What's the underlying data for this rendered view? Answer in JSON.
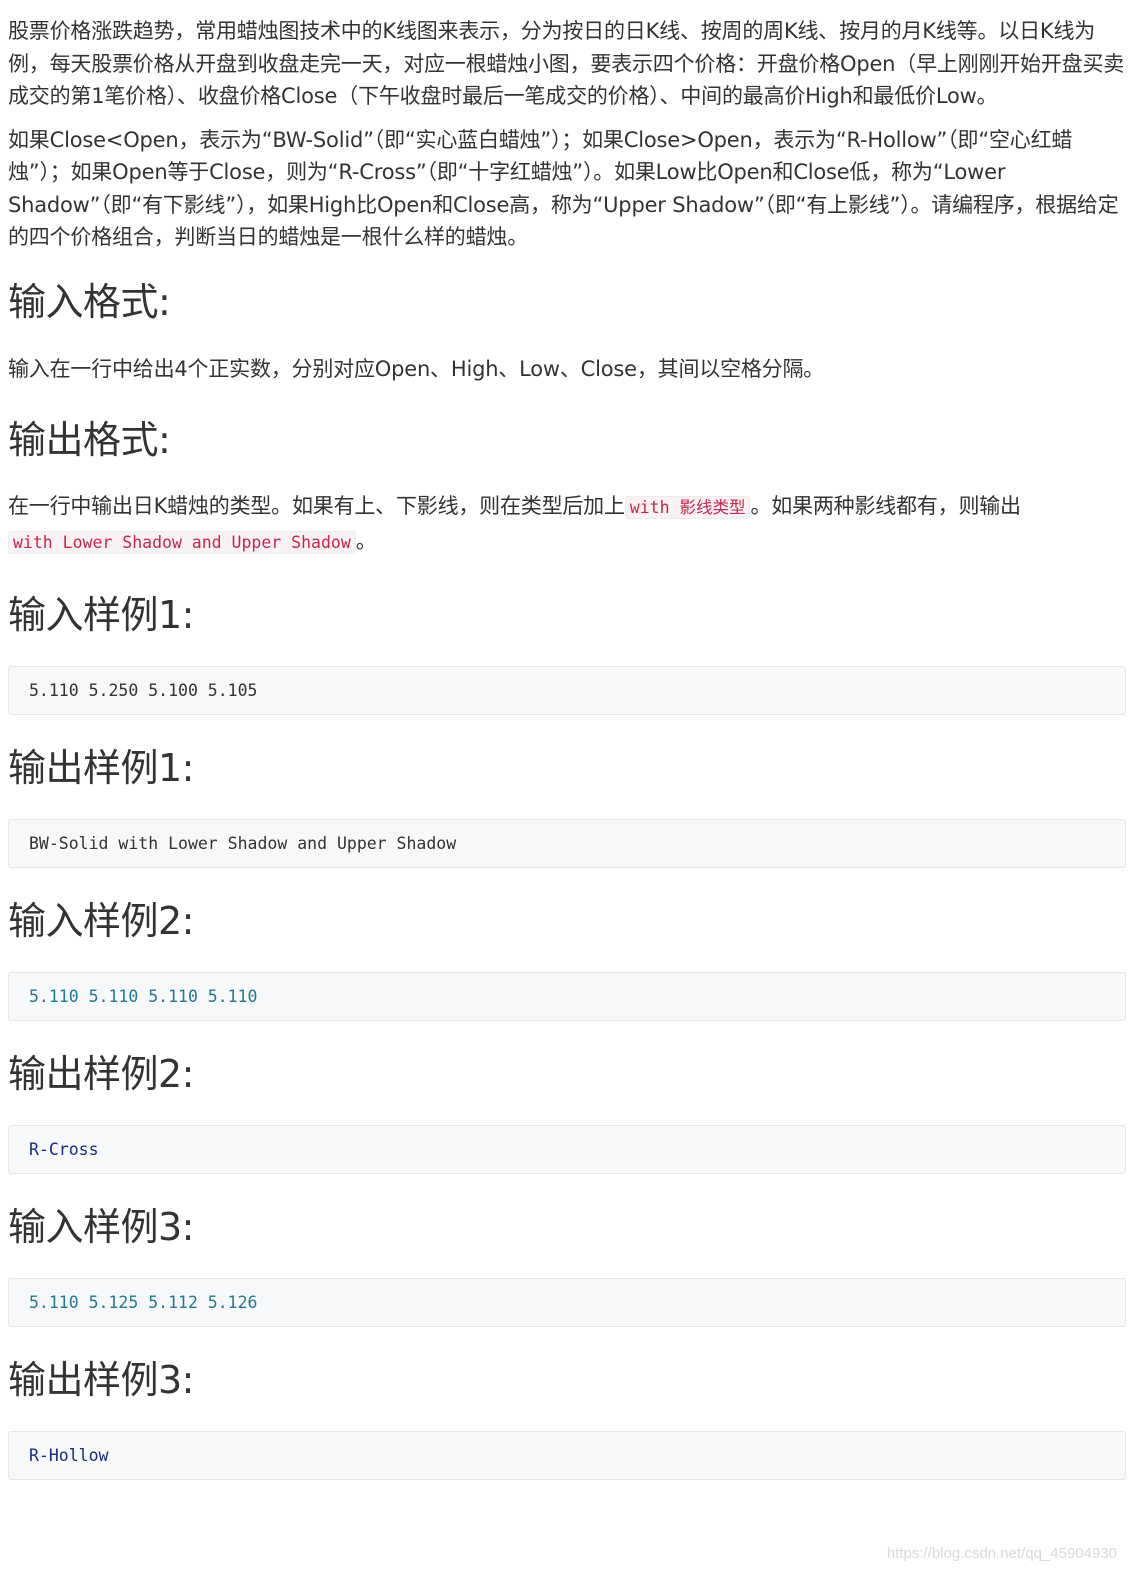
{
  "description": {
    "paragraph1": "股票价格涨跌趋势，常用蜡烛图技术中的K线图来表示，分为按日的日K线、按周的周K线、按月的月K线等。以日K线为例，每天股票价格从开盘到收盘走完一天，对应一根蜡烛小图，要表示四个价格：开盘价格Open（早上刚刚开始开盘买卖成交的第1笔价格）、收盘价格Close（下午收盘时最后一笔成交的价格）、中间的最高价High和最低价Low。",
    "paragraph2": "如果Close<Open，表示为“BW-Solid”（即“实心蓝白蜡烛”）；如果Close>Open，表示为“R-Hollow”（即“空心红蜡烛”）；如果Open等于Close，则为“R-Cross”（即“十字红蜡烛”）。如果Low比Open和Close低，称为“Lower Shadow”（即“有下影线”），如果High比Open和Close高，称为“Upper Shadow”（即“有上影线”）。请编程序，根据给定的四个价格组合，判断当日的蜡烛是一根什么样的蜡烛。"
  },
  "input_format": {
    "heading": "输入格式:",
    "text": "输入在一行中给出4个正实数，分别对应Open、High、Low、Close，其间以空格分隔。"
  },
  "output_format": {
    "heading": "输出格式:",
    "text_before": "在一行中输出日K蜡烛的类型。如果有上、下影线，则在类型后加上",
    "code1": "with 影线类型",
    "text_middle": "。如果两种影线都有，则输出",
    "code2": "with Lower Shadow and Upper Shadow",
    "text_after": "。"
  },
  "samples": [
    {
      "heading": "输入样例1:",
      "code": "5.110 5.250 5.100 5.105"
    },
    {
      "heading": "输出样例1:",
      "code": "BW-Solid with Lower Shadow and Upper Shadow"
    },
    {
      "heading": "输入样例2:",
      "code": "5.110 5.110 5.110 5.110"
    },
    {
      "heading": "输出样例2:",
      "code": "R-Cross"
    },
    {
      "heading": "输入样例3:",
      "code": "5.110 5.125 5.112 5.126"
    },
    {
      "heading": "输出样例3:",
      "code": "R-Hollow"
    }
  ],
  "watermark": "https://blog.csdn.net/qq_45904930",
  "colors": {
    "text": "#333333",
    "inline_code": "#c7254e",
    "code_number": "#1f7a8c",
    "code_identifier": "#1b2a78",
    "code_background": "#f6f8fa"
  }
}
